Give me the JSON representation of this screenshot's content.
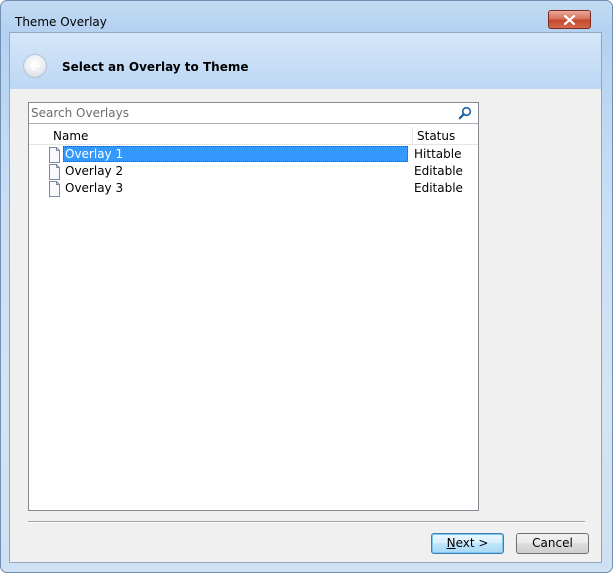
{
  "window": {
    "title": "Theme Overlay"
  },
  "header": {
    "title": "Select an Overlay to Theme"
  },
  "search": {
    "placeholder": "Search Overlays"
  },
  "list": {
    "columns": {
      "name": "Name",
      "status": "Status"
    },
    "rows": [
      {
        "name": "Overlay 1",
        "status": "Hittable",
        "selected": true
      },
      {
        "name": "Overlay 2",
        "status": "Editable",
        "selected": false
      },
      {
        "name": "Overlay 3",
        "status": "Editable",
        "selected": false
      }
    ]
  },
  "buttons": {
    "next_mnemonic": "N",
    "next_rest": "ext >",
    "cancel": "Cancel"
  },
  "colors": {
    "selection": "#3399ff",
    "close_button": "#c5482b"
  },
  "icons": {
    "close": "close-icon",
    "back": "back-arrow-icon",
    "search": "search-icon",
    "document": "document-icon"
  }
}
